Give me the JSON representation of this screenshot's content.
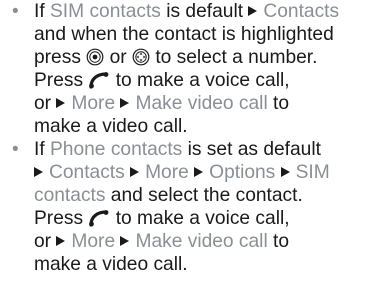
{
  "items": [
    {
      "lines": [
        [
          {
            "t": "If ",
            "c": "k"
          },
          {
            "t": "SIM contacts",
            "c": "g"
          },
          {
            "t": " is default ",
            "c": "k"
          },
          {
            "t": "Contacts",
            "c": "ga"
          }
        ],
        [
          {
            "t": "and when the contact is highlighted",
            "c": "k"
          }
        ],
        [
          {
            "t": "press ",
            "c": "k"
          },
          {
            "icon": "nav-select-key-icon"
          },
          {
            "t": " or ",
            "c": "k"
          },
          {
            "icon": "nav-key-icon"
          },
          {
            "t": " to select a number.",
            "c": "k"
          }
        ],
        [
          {
            "t": "Press ",
            "c": "k"
          },
          {
            "icon": "call-key-icon"
          },
          {
            "t": " to make a voice call,",
            "c": "k"
          }
        ],
        [
          {
            "t": "or ",
            "c": "k"
          },
          {
            "t": "More",
            "c": "ga"
          },
          {
            "t": " ",
            "c": "k"
          },
          {
            "t": "Make video call",
            "c": "ga"
          },
          {
            "t": " to",
            "c": "k"
          }
        ],
        [
          {
            "t": "make a video call.",
            "c": "k"
          }
        ]
      ]
    },
    {
      "lines": [
        [
          {
            "t": "If ",
            "c": "k"
          },
          {
            "t": "Phone contacts",
            "c": "g"
          },
          {
            "t": " is set as default",
            "c": "k"
          }
        ],
        [
          {
            "t": "Contacts",
            "c": "ga"
          },
          {
            "t": " ",
            "c": "k"
          },
          {
            "t": "More",
            "c": "ga"
          },
          {
            "t": " ",
            "c": "k"
          },
          {
            "t": "Options",
            "c": "ga"
          },
          {
            "t": " ",
            "c": "k"
          },
          {
            "t": "SIM",
            "c": "ga"
          }
        ],
        [
          {
            "t": "contacts",
            "c": "g"
          },
          {
            "t": " and select the contact.",
            "c": "k"
          }
        ],
        [
          {
            "t": "Press ",
            "c": "k"
          },
          {
            "icon": "call-key-icon"
          },
          {
            "t": " to make a voice call,",
            "c": "k"
          }
        ],
        [
          {
            "t": "or ",
            "c": "k"
          },
          {
            "t": "More",
            "c": "ga"
          },
          {
            "t": " ",
            "c": "k"
          },
          {
            "t": "Make video call",
            "c": "ga"
          },
          {
            "t": " to",
            "c": "k"
          }
        ],
        [
          {
            "t": "make a video call.",
            "c": "k"
          }
        ]
      ]
    }
  ],
  "colors": {
    "text": "#1a1a1a",
    "highlight": "#8a8f96"
  }
}
